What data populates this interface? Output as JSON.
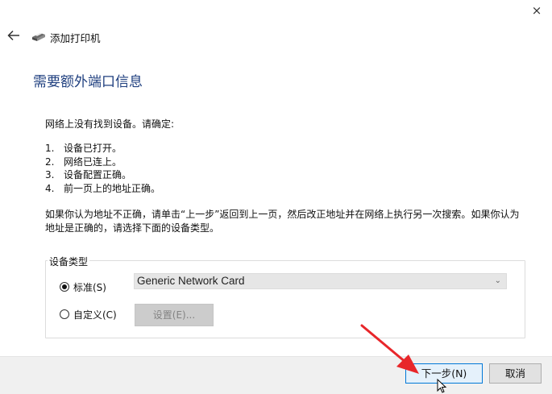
{
  "window": {
    "title": "添加打印机",
    "close_glyph": "×",
    "icons": [
      "back-arrow-icon",
      "printer-icon",
      "close-icon"
    ]
  },
  "page": {
    "heading": "需要额外端口信息",
    "intro": "网络上没有找到设备。请确定:",
    "checklist": [
      {
        "num": "1.",
        "text": "设备已打开。"
      },
      {
        "num": "2.",
        "text": "网络已连上。"
      },
      {
        "num": "3.",
        "text": "设备配置正确。"
      },
      {
        "num": "4.",
        "text": "前一页上的地址正确。"
      }
    ],
    "paragraph": "如果你认为地址不正确，请单击“上一步”返回到上一页，然后改正地址并在网络上执行另一次搜索。如果你认为地址是正确的，请选择下面的设备类型。"
  },
  "device_type": {
    "group_label": "设备类型",
    "standard_label": "标准(S)",
    "standard_selected": true,
    "custom_label": "自定义(C)",
    "custom_selected": false,
    "select_value": "Generic Network Card",
    "settings_label": "设置(E)..."
  },
  "footer": {
    "next_label": "下一步(N)",
    "cancel_label": "取消"
  },
  "colors": {
    "heading": "#1f3f7f",
    "annotation_arrow": "#e8262a",
    "focus_border": "#0078d7"
  }
}
